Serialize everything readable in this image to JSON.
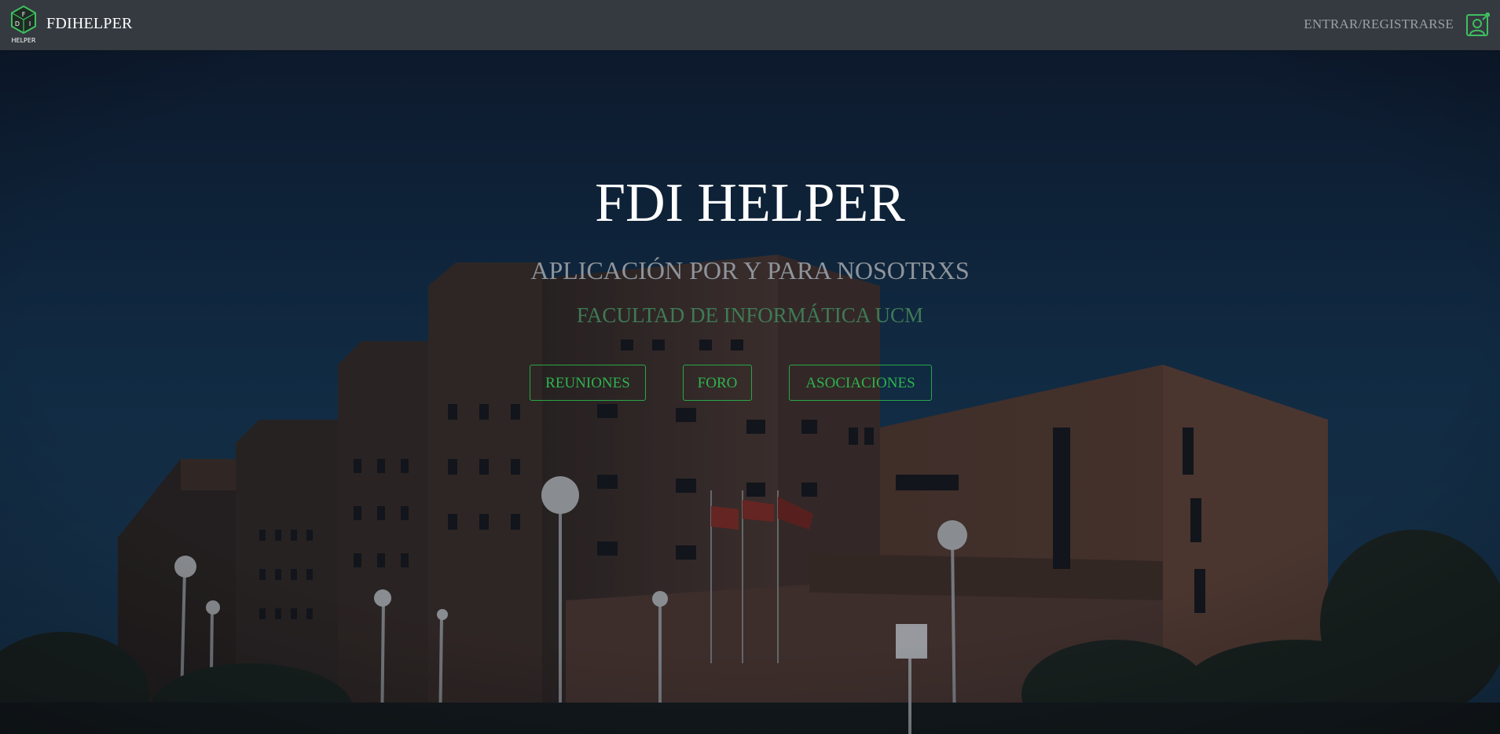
{
  "navbar": {
    "logo_alt": "FDI helper logo",
    "logo_letters": [
      "F",
      "D",
      "I"
    ],
    "logo_caption": "HELPER",
    "brand": "FDIHELPER",
    "login_label": "ENTRAR/REGISTRARSE",
    "login_icon": "user-profile-icon"
  },
  "hero": {
    "title": "FDI HELPER",
    "subtitle": "APLICACIÓN POR Y PARA NOSOTRXS",
    "faculty": "FACULTAD DE INFORMÁTICA UCM",
    "buttons": {
      "reuniones": "REUNIONES",
      "foro": "FORO",
      "asociaciones": "ASOCIACIONES"
    },
    "background": "Facultad de Informática UCM building photo"
  },
  "colors": {
    "navbar": "#343a40",
    "accent": "#28a745",
    "faculty_text": "#3f7a55",
    "subtitle_text": "#8e949b"
  }
}
